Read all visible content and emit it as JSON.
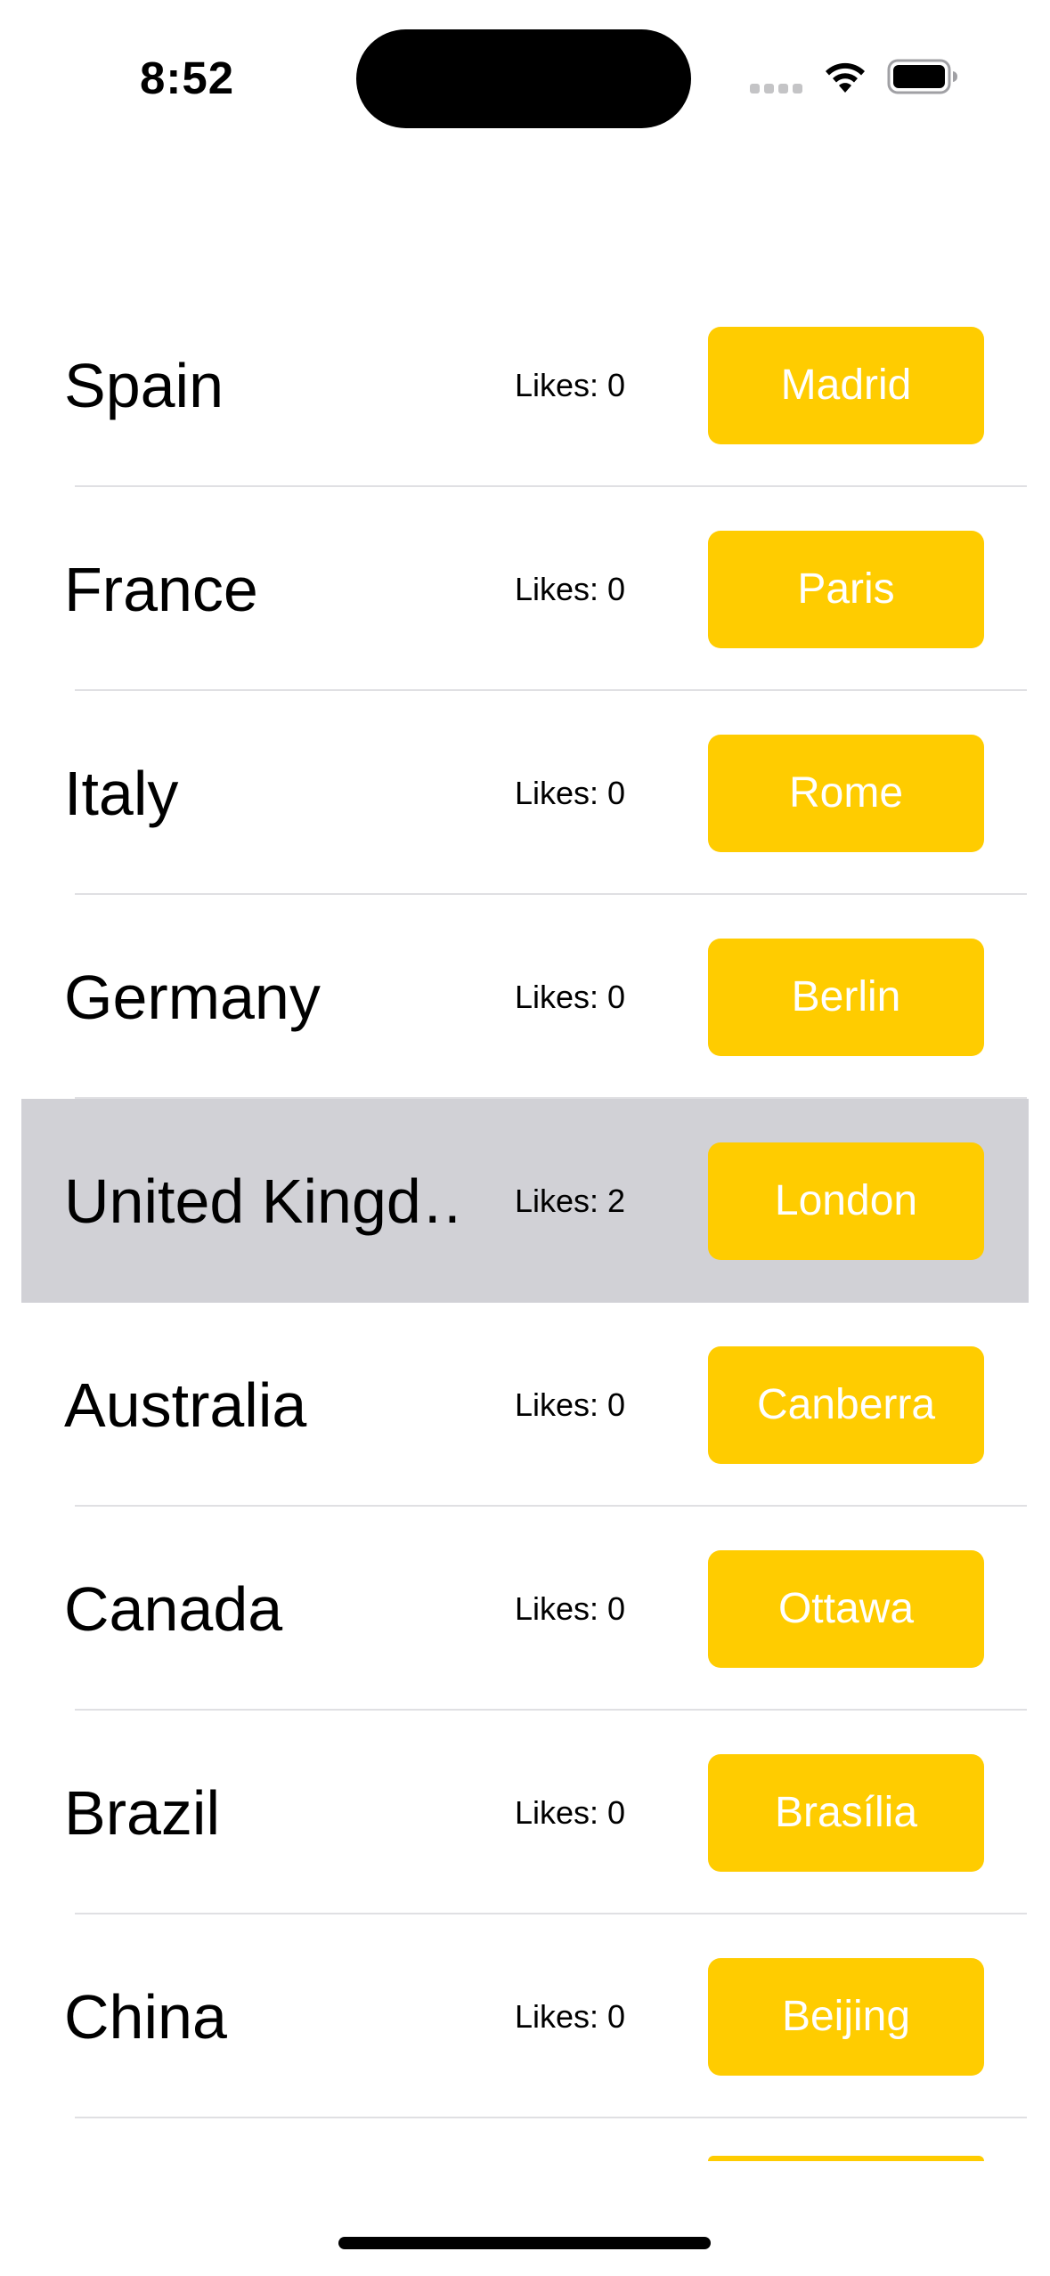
{
  "status_bar": {
    "time": "8:52"
  },
  "countries": [
    {
      "name": "Spain",
      "likes": "Likes: 0",
      "capital": "Madrid",
      "selected": false
    },
    {
      "name": "France",
      "likes": "Likes: 0",
      "capital": "Paris",
      "selected": false
    },
    {
      "name": "Italy",
      "likes": "Likes: 0",
      "capital": "Rome",
      "selected": false
    },
    {
      "name": "Germany",
      "likes": "Likes: 0",
      "capital": "Berlin",
      "selected": false
    },
    {
      "name": "United Kingd…",
      "likes": "Likes: 2",
      "capital": "London",
      "selected": true
    },
    {
      "name": "Australia",
      "likes": "Likes: 0",
      "capital": "Canberra",
      "selected": false
    },
    {
      "name": "Canada",
      "likes": "Likes: 0",
      "capital": "Ottawa",
      "selected": false
    },
    {
      "name": "Brazil",
      "likes": "Likes: 0",
      "capital": "Brasília",
      "selected": false
    },
    {
      "name": "China",
      "likes": "Likes: 0",
      "capital": "Beijing",
      "selected": false
    }
  ],
  "colors": {
    "button": "#ffcc00",
    "button_text": "#ffffff",
    "selected_row": "#d1d1d6",
    "separator": "#e0e0e3"
  }
}
